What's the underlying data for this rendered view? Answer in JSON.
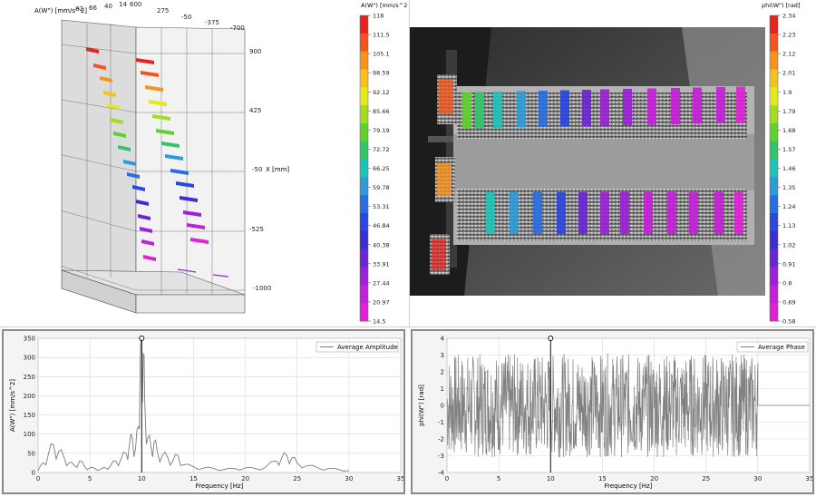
{
  "view3d": {
    "z_title": "A(W\") [mm/s^2]",
    "x_axis_label": "X [mm]",
    "top_ticks": [
      "82",
      "66",
      "40",
      "14",
      "600",
      "275",
      "-50",
      "-375",
      "-700"
    ],
    "right_ticks": [
      "900",
      "425",
      "-50",
      "-525",
      "-1000"
    ]
  },
  "colorbar_amplitude": {
    "title": "A(W\") [mm/s^2]",
    "ticks": [
      "118",
      "111.5",
      "105.1",
      "98.59",
      "92.12",
      "85.66",
      "79.19",
      "72.72",
      "66.25",
      "59.78",
      "53.31",
      "46.84",
      "40.38",
      "33.91",
      "27.44",
      "20.97",
      "14.5"
    ],
    "colors": [
      "#e8221d",
      "#f2561c",
      "#f7921c",
      "#f4c21c",
      "#e3e71d",
      "#a4dc22",
      "#5fd12b",
      "#31c46a",
      "#1fc1b9",
      "#2f9bd6",
      "#2a6ee0",
      "#2b47de",
      "#3b2fd4",
      "#6a26d2",
      "#9b22d6",
      "#c420d7",
      "#e021d8"
    ]
  },
  "colorbar_phase": {
    "title": "phi(W\") [rad]",
    "ticks": [
      "2.34",
      "2.23",
      "2.12",
      "2.01",
      "1.9",
      "1.79",
      "1.68",
      "1.57",
      "1.46",
      "1.35",
      "1.24",
      "1.13",
      "1.02",
      "0.91",
      "0.8",
      "0.69",
      "0.58"
    ],
    "colors": [
      "#e8221d",
      "#f2561c",
      "#f7921c",
      "#f4c21c",
      "#e3e71d",
      "#a4dc22",
      "#5fd12b",
      "#31c46a",
      "#1fc1b9",
      "#2f9bd6",
      "#2a6ee0",
      "#2b47de",
      "#3b2fd4",
      "#6a26d2",
      "#9b22d6",
      "#c420d7",
      "#e021d8"
    ]
  },
  "chart_data": [
    {
      "type": "line",
      "title": "",
      "xlabel": "Frequency [Hz]",
      "ylabel": "A(W\") [mm/s^2]",
      "xlim": [
        0,
        35
      ],
      "ylim": [
        0,
        350
      ],
      "xticks": [
        0,
        5,
        10,
        15,
        20,
        25,
        30,
        35
      ],
      "yticks": [
        0,
        50,
        100,
        150,
        200,
        250,
        300,
        350
      ],
      "grid": true,
      "legend": "top-right",
      "series": [
        {
          "name": "Average Amplitude",
          "x": [
            0,
            0.5,
            1,
            1.5,
            2,
            2.5,
            3,
            3.5,
            4,
            4.5,
            5,
            5.5,
            6,
            6.5,
            7,
            7.5,
            8,
            8.5,
            8.8,
            9.1,
            9.4,
            9.7,
            9.85,
            10,
            10.15,
            10.3,
            10.6,
            10.9,
            11.2,
            11.5,
            12,
            12.5,
            13,
            13.5,
            14,
            15,
            16,
            17,
            18,
            19,
            20,
            21,
            22,
            23,
            23.5,
            24,
            24.5,
            25,
            26,
            27,
            28,
            29,
            30
          ],
          "y": [
            5,
            25,
            48,
            72,
            55,
            40,
            25,
            18,
            30,
            15,
            12,
            10,
            8,
            12,
            18,
            30,
            35,
            50,
            70,
            90,
            60,
            120,
            290,
            350,
            310,
            180,
            90,
            65,
            80,
            55,
            45,
            40,
            30,
            45,
            20,
            15,
            12,
            10,
            8,
            10,
            12,
            10,
            15,
            30,
            38,
            45,
            38,
            25,
            18,
            12,
            10,
            8,
            5
          ]
        }
      ],
      "marker": {
        "x": 10,
        "y": 350
      }
    },
    {
      "type": "line",
      "title": "",
      "xlabel": "Frequency [Hz]",
      "ylabel": "phi(W\") [rad]",
      "xlim": [
        0,
        35
      ],
      "ylim": [
        -4,
        4
      ],
      "xticks": [
        0,
        5,
        10,
        15,
        20,
        25,
        30,
        35
      ],
      "yticks": [
        4,
        3,
        2,
        1,
        0,
        -1,
        -2,
        -3,
        -4
      ],
      "grid": true,
      "legend": "top-right",
      "series": [
        {
          "name": "Average Phase",
          "x_range": [
            0,
            30
          ],
          "y_range": [
            -3.1,
            3.1
          ],
          "after_x": 30,
          "after_y": 0
        }
      ],
      "marker": {
        "x": 10,
        "y": 4
      }
    }
  ]
}
